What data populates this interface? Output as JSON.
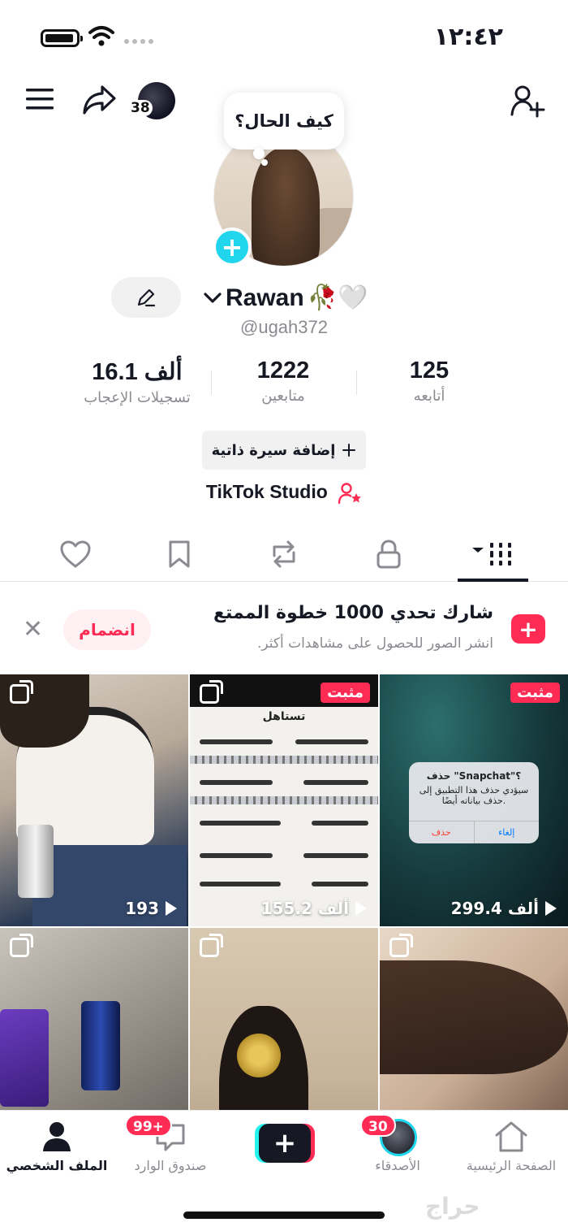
{
  "status_bar": {
    "time": "١٢:٤٢"
  },
  "top_bar": {
    "notification_count": "38"
  },
  "profile": {
    "note_bubble": "كيف الحال؟",
    "display_name": "Rawan",
    "name_emojis": "🥀🤍",
    "username": "@ugah372",
    "stats": [
      {
        "value": "125",
        "label": "أتابعه"
      },
      {
        "value": "1222",
        "label": "متابعين"
      },
      {
        "value": "16.1 ألف",
        "label": "تسجيلات الإعجاب"
      }
    ],
    "add_bio_label": "إضافة سيرة ذاتية",
    "studio_label": "TikTok Studio"
  },
  "challenge": {
    "title": "شارك تحدي 1000 خطوة الممتع",
    "subtitle": "انشر الصور للحصول على مشاهدات أكثر.",
    "join_label": "انضمام"
  },
  "posts": [
    {
      "views": "193",
      "pinned": ""
    },
    {
      "views": "155.2 ألف",
      "pinned": "مثبت",
      "heading": "تستاهل"
    },
    {
      "views": "299.4 ألف",
      "pinned": "مثبت",
      "dialog_title": "حذف \"Snapchat\"؟",
      "dialog_body": "سيؤدي حذف هذا التطبيق إلى حذف بياناته أيضًا.",
      "dialog_cancel": "إلغاء",
      "dialog_delete": "حذف"
    },
    {
      "views": "",
      "pinned": ""
    },
    {
      "views": "",
      "pinned": ""
    },
    {
      "views": "",
      "pinned": ""
    }
  ],
  "bottom_nav": {
    "home": "الصفحة الرئيسية",
    "friends": "الأصدقاء",
    "friends_badge": "30",
    "inbox": "صندوق الوارد",
    "inbox_badge": "99+",
    "profile": "الملف الشخصي"
  },
  "watermark": "حراج",
  "colors": {
    "accent": "#fe2c55",
    "cyan": "#20d5ec",
    "text": "#161823",
    "muted": "#8a8b91"
  }
}
